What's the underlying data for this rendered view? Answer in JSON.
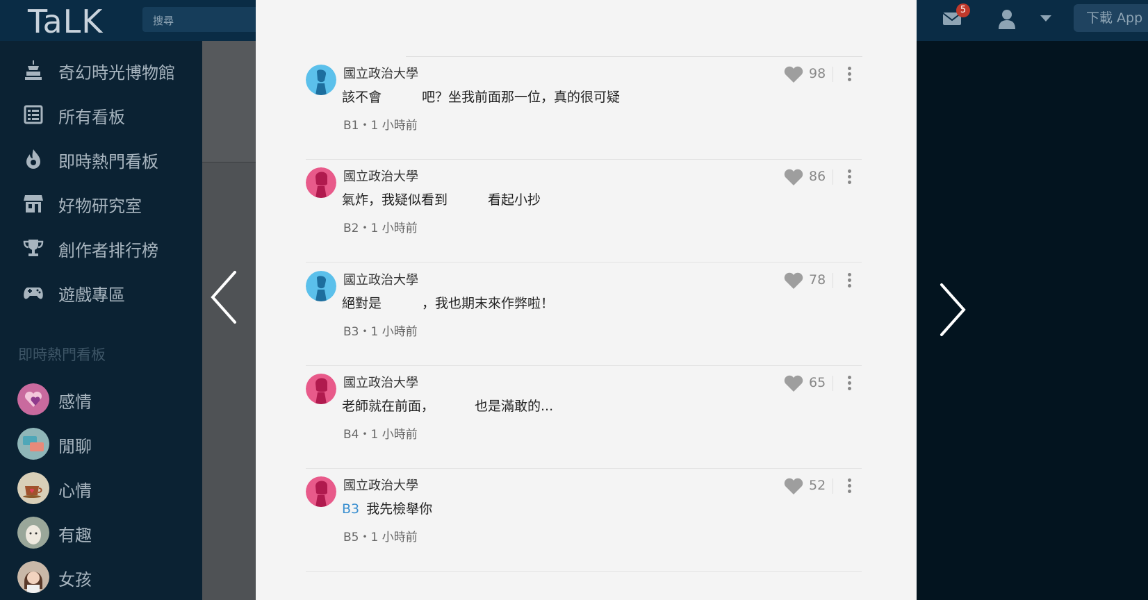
{
  "topbar": {
    "logo": "TaLK",
    "search_placeholder": "搜尋",
    "mail_badge": "5",
    "download_app": "下載 App"
  },
  "sidebar": {
    "items": [
      {
        "icon": "museum-icon",
        "label": "奇幻時光博物館"
      },
      {
        "icon": "list-icon",
        "label": "所有看板"
      },
      {
        "icon": "fire-icon",
        "label": "即時熱門看板"
      },
      {
        "icon": "store-icon",
        "label": "好物研究室"
      },
      {
        "icon": "trophy-icon",
        "label": "創作者排行榜"
      },
      {
        "icon": "gamepad-icon",
        "label": "遊戲專區"
      }
    ],
    "section_title": "即時熱門看板",
    "boards": [
      {
        "label": "感情"
      },
      {
        "label": "閒聊"
      },
      {
        "label": "心情"
      },
      {
        "label": "有趣"
      },
      {
        "label": "女孩"
      }
    ]
  },
  "comments": [
    {
      "author": "國立政治大學",
      "avatar": "male",
      "text_a": "該不會",
      "text_b": "吧？坐我前面那一位，真的很可疑",
      "meta": "B1・1 小時前",
      "likes": "98"
    },
    {
      "author": "國立政治大學",
      "avatar": "female",
      "text_a": "氣炸，我疑似看到",
      "text_b": "看起小抄",
      "meta": "B2・1 小時前",
      "likes": "86"
    },
    {
      "author": "國立政治大學",
      "avatar": "male",
      "text_a": "絕對是",
      "text_b": "，我也期末來作弊啦！",
      "meta": "B3・1 小時前",
      "likes": "78"
    },
    {
      "author": "國立政治大學",
      "avatar": "female",
      "text_a": "老師就在前面，",
      "text_b": "也是滿敢的...",
      "meta": "B4・1 小時前",
      "likes": "65"
    },
    {
      "author": "國立政治大學",
      "avatar": "female",
      "ref": "B3",
      "text_a": "我先檢舉你",
      "text_b": "",
      "meta": "B5・1 小時前",
      "likes": "52"
    }
  ],
  "colors": {
    "topbar": "#0a2c45",
    "sidebar": "#0b2233",
    "modal": "#f4f4f4",
    "male_avatar": "#5bc0eb",
    "female_avatar": "#e85a8a",
    "ref_link": "#3a8fd0"
  }
}
